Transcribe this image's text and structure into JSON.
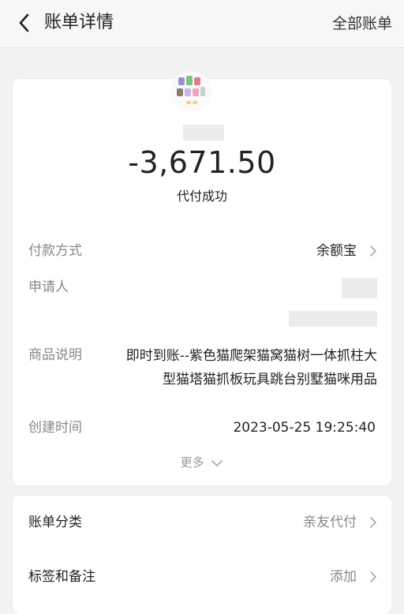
{
  "header": {
    "title": "账单详情",
    "right_link": "全部账单"
  },
  "summary": {
    "amount": "-3,671.50",
    "status": "代付成功"
  },
  "details": {
    "payment_method_label": "付款方式",
    "payment_method_value": "余额宝",
    "applicant_label": "申请人",
    "product_label": "商品说明",
    "product_line1": "即时到账--紫色猫爬架猫窝猫树一体抓柱大",
    "product_line2": "型猫塔猫抓板玩具跳台别墅猫咪用品",
    "created_label": "创建时间",
    "created_value": "2023-05-25 19:25:40",
    "more_label": "更多"
  },
  "bottom": {
    "category_label": "账单分类",
    "category_value": "亲友代付",
    "tags_label": "标签和备注",
    "tags_value": "添加"
  },
  "icons": {
    "back": "back-arrow-icon",
    "chevron": "chevron-right-icon",
    "more": "chevron-down-icon"
  },
  "colors": {
    "background": "#f2f2f2",
    "card": "#ffffff",
    "muted_text": "#888888",
    "placeholder": "#ececec"
  }
}
